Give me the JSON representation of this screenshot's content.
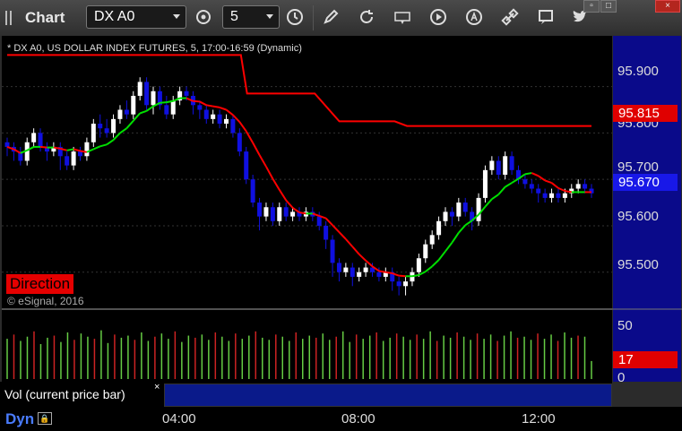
{
  "toolbar": {
    "title": "Chart",
    "symbol": "DX A0",
    "interval": "5",
    "icons": [
      "settings-gear-icon",
      "clock-icon",
      "draw-pencil-icon",
      "refresh-icon",
      "get-icon",
      "play-icon",
      "alert-icon",
      "link-icon",
      "chat-icon",
      "twitter-icon"
    ]
  },
  "window_buttons": {
    "restore": "▫",
    "maximize": "□",
    "close": "×"
  },
  "chart": {
    "title": "* DX A0, US DOLLAR INDEX FUTURES, 5, 17:00-16:59 (Dynamic)",
    "study_label": "Direction",
    "copyright": "© eSignal, 2016",
    "price_axis": [
      "95.900",
      "95.800",
      "95.700",
      "95.600",
      "95.500"
    ],
    "tags": {
      "red_line": "95.815",
      "last_price": "95.670",
      "volume": "17"
    },
    "volume_axis": [
      "50",
      "0"
    ],
    "volume_panel_label": "Vol (current price bar)",
    "volume_close": "×",
    "time_axis": [
      "04:00",
      "08:00",
      "12:00"
    ],
    "dyn_label": "Dyn",
    "dyn_icon": "lock-icon",
    "colors": {
      "up": "#ffffff",
      "down": "#1010e0",
      "ma_up": "#00e000",
      "ma_down": "#ff0000",
      "ref_line": "#ff0000",
      "vol_up": "#66cc44",
      "vol_down": "#cc2222"
    }
  },
  "chart_data": {
    "type": "candlestick",
    "title": "DX A0, US DOLLAR INDEX FUTURES, 5, 17:00-16:59 (Dynamic)",
    "ylim": [
      95.43,
      95.99
    ],
    "ref_line": [
      [
        0,
        95.968
      ],
      [
        38,
        95.968
      ],
      [
        39,
        95.885
      ],
      [
        50,
        95.885
      ],
      [
        54,
        95.825
      ],
      [
        63,
        95.825
      ],
      [
        65,
        95.815
      ],
      [
        95,
        95.815
      ]
    ],
    "candles": [
      [
        95.78,
        95.77,
        95.79,
        95.75
      ],
      [
        95.77,
        95.76,
        95.78,
        95.74
      ],
      [
        95.76,
        95.74,
        95.77,
        95.73
      ],
      [
        95.74,
        95.78,
        95.79,
        95.73
      ],
      [
        95.78,
        95.8,
        95.81,
        95.77
      ],
      [
        95.8,
        95.77,
        95.81,
        95.76
      ],
      [
        95.77,
        95.76,
        95.78,
        95.74
      ],
      [
        95.76,
        95.77,
        95.78,
        95.75
      ],
      [
        95.77,
        95.75,
        95.78,
        95.72
      ],
      [
        95.75,
        95.73,
        95.76,
        95.72
      ],
      [
        95.73,
        95.76,
        95.77,
        95.72
      ],
      [
        95.76,
        95.75,
        95.77,
        95.74
      ],
      [
        95.75,
        95.78,
        95.79,
        95.74
      ],
      [
        95.78,
        95.82,
        95.83,
        95.77
      ],
      [
        95.82,
        95.81,
        95.84,
        95.79
      ],
      [
        95.81,
        95.8,
        95.83,
        95.79
      ],
      [
        95.8,
        95.83,
        95.84,
        95.79
      ],
      [
        95.83,
        95.85,
        95.86,
        95.82
      ],
      [
        95.85,
        95.84,
        95.87,
        95.83
      ],
      [
        95.84,
        95.88,
        95.89,
        95.83
      ],
      [
        95.88,
        95.91,
        95.92,
        95.87
      ],
      [
        95.91,
        95.86,
        95.92,
        95.85
      ],
      [
        95.86,
        95.89,
        95.9,
        95.84
      ],
      [
        95.89,
        95.86,
        95.9,
        95.85
      ],
      [
        95.86,
        95.84,
        95.88,
        95.83
      ],
      [
        95.84,
        95.87,
        95.88,
        95.83
      ],
      [
        95.87,
        95.89,
        95.9,
        95.86
      ],
      [
        95.89,
        95.88,
        95.9,
        95.87
      ],
      [
        95.88,
        95.86,
        95.89,
        95.84
      ],
      [
        95.86,
        95.85,
        95.87,
        95.83
      ],
      [
        95.85,
        95.83,
        95.86,
        95.82
      ],
      [
        95.83,
        95.84,
        95.85,
        95.82
      ],
      [
        95.84,
        95.82,
        95.85,
        95.81
      ],
      [
        95.82,
        95.83,
        95.84,
        95.81
      ],
      [
        95.83,
        95.8,
        95.84,
        95.79
      ],
      [
        95.8,
        95.76,
        95.81,
        95.75
      ],
      [
        95.76,
        95.7,
        95.77,
        95.69
      ],
      [
        95.7,
        95.65,
        95.71,
        95.64
      ],
      [
        95.65,
        95.62,
        95.66,
        95.59
      ],
      [
        95.62,
        95.64,
        95.65,
        95.61
      ],
      [
        95.64,
        95.61,
        95.65,
        95.6
      ],
      [
        95.61,
        95.64,
        95.65,
        95.6
      ],
      [
        95.64,
        95.62,
        95.65,
        95.61
      ],
      [
        95.62,
        95.63,
        95.64,
        95.61
      ],
      [
        95.63,
        95.62,
        95.64,
        95.61
      ],
      [
        95.62,
        95.63,
        95.64,
        95.61
      ],
      [
        95.63,
        95.62,
        95.64,
        95.61
      ],
      [
        95.62,
        95.6,
        95.63,
        95.59
      ],
      [
        95.6,
        95.57,
        95.61,
        95.55
      ],
      [
        95.57,
        95.52,
        95.58,
        95.49
      ],
      [
        95.52,
        95.5,
        95.53,
        95.48
      ],
      [
        95.5,
        95.51,
        95.52,
        95.49
      ],
      [
        95.51,
        95.49,
        95.52,
        95.47
      ],
      [
        95.49,
        95.5,
        95.51,
        95.48
      ],
      [
        95.5,
        95.51,
        95.52,
        95.49
      ],
      [
        95.51,
        95.5,
        95.52,
        95.49
      ],
      [
        95.5,
        95.49,
        95.51,
        95.48
      ],
      [
        95.49,
        95.5,
        95.51,
        95.48
      ],
      [
        95.5,
        95.48,
        95.51,
        95.46
      ],
      [
        95.48,
        95.47,
        95.49,
        95.45
      ],
      [
        95.47,
        95.48,
        95.49,
        95.45
      ],
      [
        95.48,
        95.5,
        95.51,
        95.47
      ],
      [
        95.5,
        95.53,
        95.54,
        95.49
      ],
      [
        95.53,
        95.56,
        95.57,
        95.52
      ],
      [
        95.56,
        95.58,
        95.59,
        95.55
      ],
      [
        95.58,
        95.61,
        95.62,
        95.57
      ],
      [
        95.61,
        95.63,
        95.64,
        95.6
      ],
      [
        95.63,
        95.62,
        95.64,
        95.6
      ],
      [
        95.62,
        95.65,
        95.66,
        95.61
      ],
      [
        95.65,
        95.63,
        95.66,
        95.62
      ],
      [
        95.63,
        95.61,
        95.64,
        95.59
      ],
      [
        95.61,
        95.66,
        95.67,
        95.6
      ],
      [
        95.66,
        95.72,
        95.73,
        95.65
      ],
      [
        95.72,
        95.74,
        95.75,
        95.71
      ],
      [
        95.74,
        95.71,
        95.75,
        95.7
      ],
      [
        95.71,
        95.75,
        95.76,
        95.7
      ],
      [
        95.75,
        95.72,
        95.76,
        95.71
      ],
      [
        95.72,
        95.7,
        95.73,
        95.69
      ],
      [
        95.7,
        95.69,
        95.71,
        95.68
      ],
      [
        95.69,
        95.68,
        95.7,
        95.67
      ],
      [
        95.68,
        95.67,
        95.69,
        95.65
      ],
      [
        95.67,
        95.66,
        95.68,
        95.65
      ],
      [
        95.66,
        95.67,
        95.68,
        95.65
      ],
      [
        95.67,
        95.66,
        95.68,
        95.65
      ],
      [
        95.66,
        95.67,
        95.68,
        95.65
      ],
      [
        95.67,
        95.68,
        95.69,
        95.66
      ],
      [
        95.68,
        95.69,
        95.7,
        95.67
      ],
      [
        95.69,
        95.68,
        95.7,
        95.67
      ],
      [
        95.68,
        95.67,
        95.69,
        95.66
      ]
    ],
    "volume": [
      38,
      42,
      36,
      40,
      45,
      33,
      39,
      41,
      35,
      44,
      37,
      43,
      40,
      38,
      46,
      34,
      42,
      39,
      41,
      37,
      44,
      36,
      40,
      43,
      38,
      45,
      35,
      41,
      39,
      42,
      37,
      44,
      40,
      36,
      43,
      38,
      41,
      45,
      39,
      37,
      42,
      40,
      36,
      44,
      38,
      41,
      39,
      43,
      37,
      40,
      45,
      35,
      42,
      38,
      41,
      44,
      36,
      39,
      43,
      40,
      37,
      42,
      38,
      45,
      36,
      41,
      39,
      44,
      40,
      37,
      43,
      38,
      42,
      36,
      41,
      45,
      39,
      40,
      37,
      43,
      38,
      42,
      36,
      44,
      39,
      41,
      40,
      17
    ],
    "volume_ylim": [
      0,
      55
    ],
    "time_axis_labels": [
      "04:00",
      "08:00",
      "12:00"
    ]
  }
}
